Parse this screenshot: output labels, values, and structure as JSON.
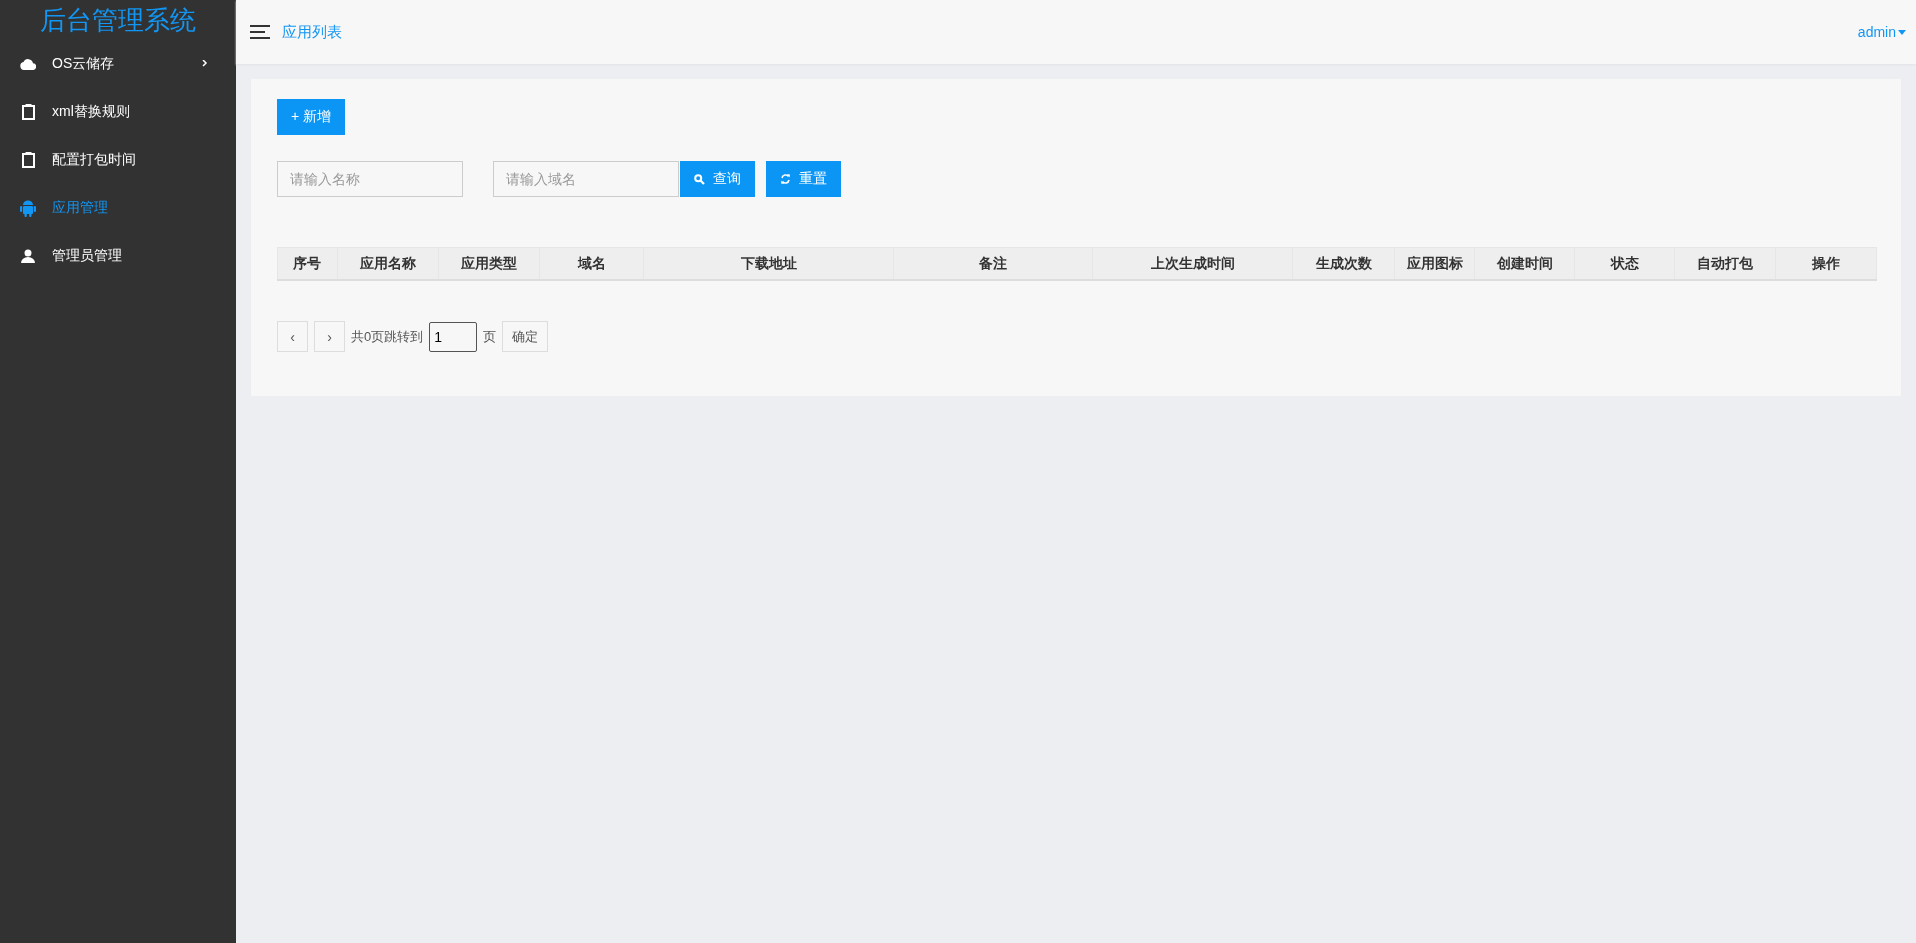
{
  "sidebar": {
    "title": "后台管理系统",
    "items": [
      {
        "label": "OS云储存",
        "kind": "group",
        "expanded": false,
        "selected": false
      },
      {
        "label": "xml替换规则",
        "kind": "link",
        "selected": false
      },
      {
        "label": "配置打包时间",
        "kind": "link",
        "selected": false
      },
      {
        "label": "应用管理",
        "kind": "link",
        "selected": true
      },
      {
        "label": "管理员管理",
        "kind": "link",
        "selected": false
      }
    ]
  },
  "topbar": {
    "title": "应用列表",
    "user": "admin"
  },
  "toolbar": {
    "add_button": "+ 新增"
  },
  "filters": {
    "name": {
      "placeholder": "请输入名称"
    },
    "domain": {
      "placeholder": "请输入域名"
    },
    "search_button": "查询",
    "reset_button": "重置"
  },
  "table": {
    "columns": [
      "序号",
      "应用名称",
      "应用类型",
      "域名",
      "下载地址",
      "备注",
      "上次生成时间",
      "生成次数",
      "应用图标",
      "创建时间",
      "状态",
      "自动打包",
      "操作"
    ]
  },
  "pagination": {
    "prev": "‹",
    "next": "›",
    "total_text": "共0页跳转到",
    "page": "1",
    "page_suffix": "页",
    "confirm": "确定"
  }
}
